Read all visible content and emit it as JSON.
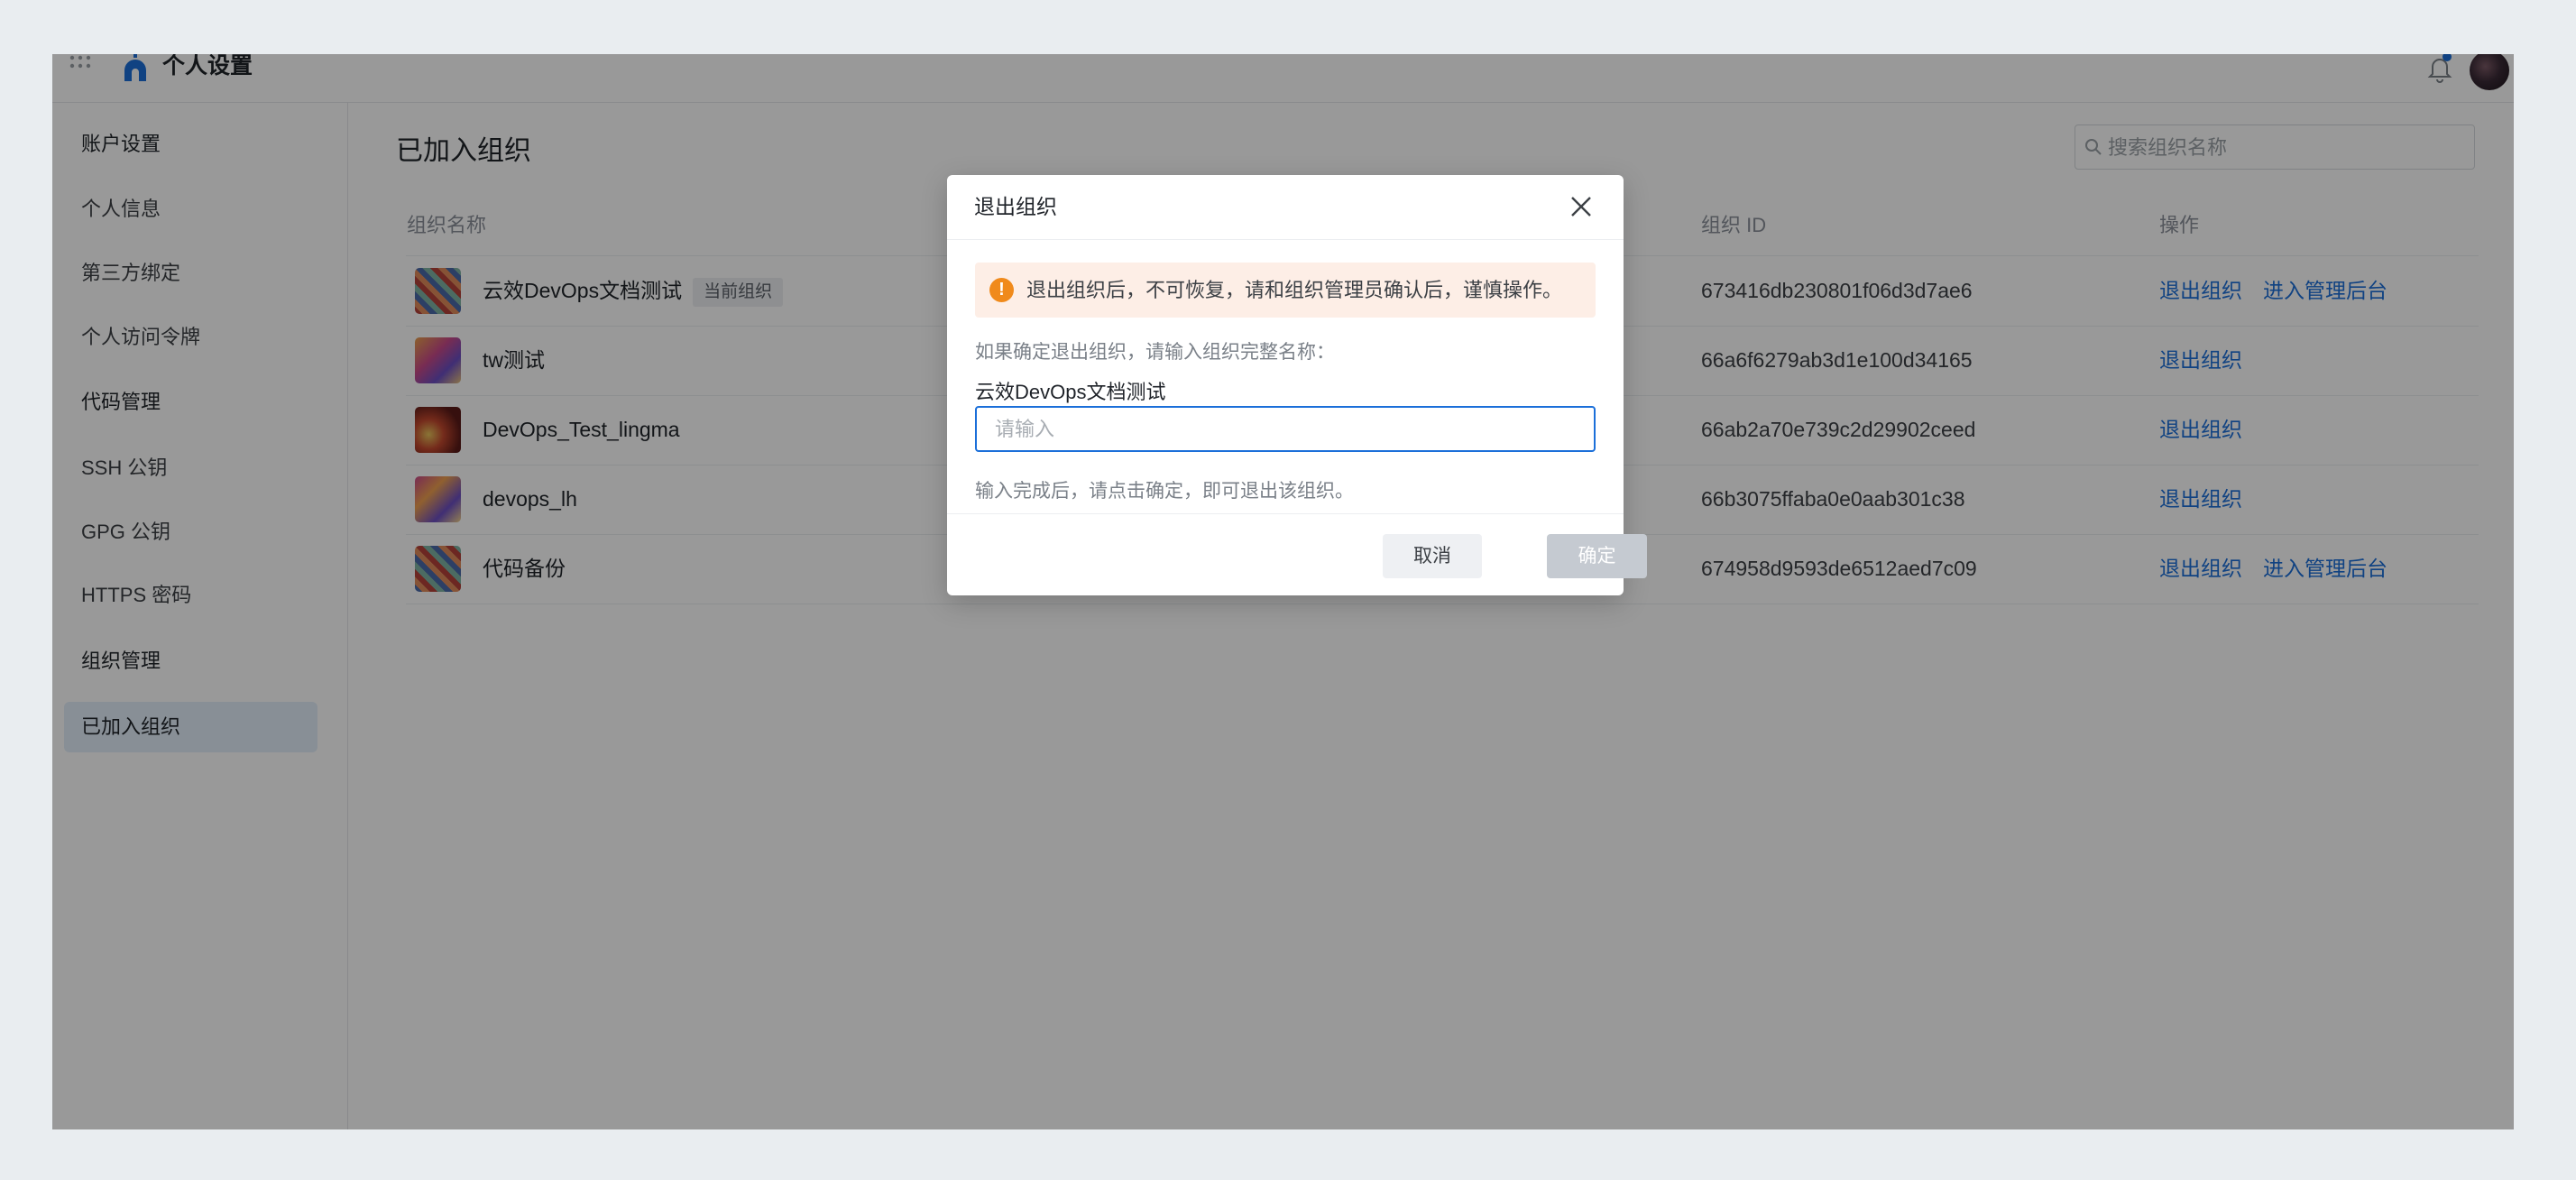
{
  "topbar": {
    "title": "个人设置"
  },
  "sidebar": {
    "items": [
      {
        "label": "账户设置",
        "type": "group"
      },
      {
        "label": "个人信息",
        "type": "item"
      },
      {
        "label": "第三方绑定",
        "type": "item"
      },
      {
        "label": "个人访问令牌",
        "type": "item"
      },
      {
        "label": "代码管理",
        "type": "group"
      },
      {
        "label": "SSH 公钥",
        "type": "item"
      },
      {
        "label": "GPG 公钥",
        "type": "item"
      },
      {
        "label": "HTTPS 密码",
        "type": "item"
      },
      {
        "label": "组织管理",
        "type": "group"
      },
      {
        "label": "已加入组织",
        "type": "item",
        "active": true
      }
    ]
  },
  "main": {
    "title": "已加入组织",
    "search": {
      "placeholder": "搜索组织名称"
    },
    "columns": {
      "name": "组织名称",
      "id": "组织 ID",
      "actions": "操作"
    },
    "rows": [
      {
        "name": "云效DevOps文档测试",
        "tag": "当前组织",
        "id": "673416db230801f06d3d7ae6",
        "actions": [
          "退出组织",
          "进入管理后台"
        ]
      },
      {
        "name": "tw测试",
        "tag": "",
        "id": "66a6f6279ab3d1e100d34165",
        "actions": [
          "退出组织"
        ]
      },
      {
        "name": "DevOps_Test_lingma",
        "tag": "",
        "id": "66ab2a70e739c2d29902ceed",
        "actions": [
          "退出组织"
        ]
      },
      {
        "name": "devops_lh",
        "tag": "",
        "id": "66b3075ffaba0e0aab301c38",
        "actions": [
          "退出组织"
        ]
      },
      {
        "name": "代码备份",
        "tag": "",
        "id": "674958d9593de6512aed7c09",
        "actions": [
          "退出组织",
          "进入管理后台"
        ]
      }
    ]
  },
  "modal": {
    "title": "退出组织",
    "alert": "退出组织后，不可恢复，请和组织管理员确认后，谨慎操作。",
    "label": "如果确定退出组织，请输入组织完整名称：",
    "org_name": "云效DevOps文档测试",
    "input_placeholder": "请输入",
    "input_value": "",
    "hint": "输入完成后，请点击确定，即可退出该组织。",
    "cancel_label": "取消",
    "ok_label": "确定"
  },
  "colors": {
    "accent": "#1b6fd9",
    "warning": "#f08a1b",
    "alert_bg": "#fdeee6"
  }
}
